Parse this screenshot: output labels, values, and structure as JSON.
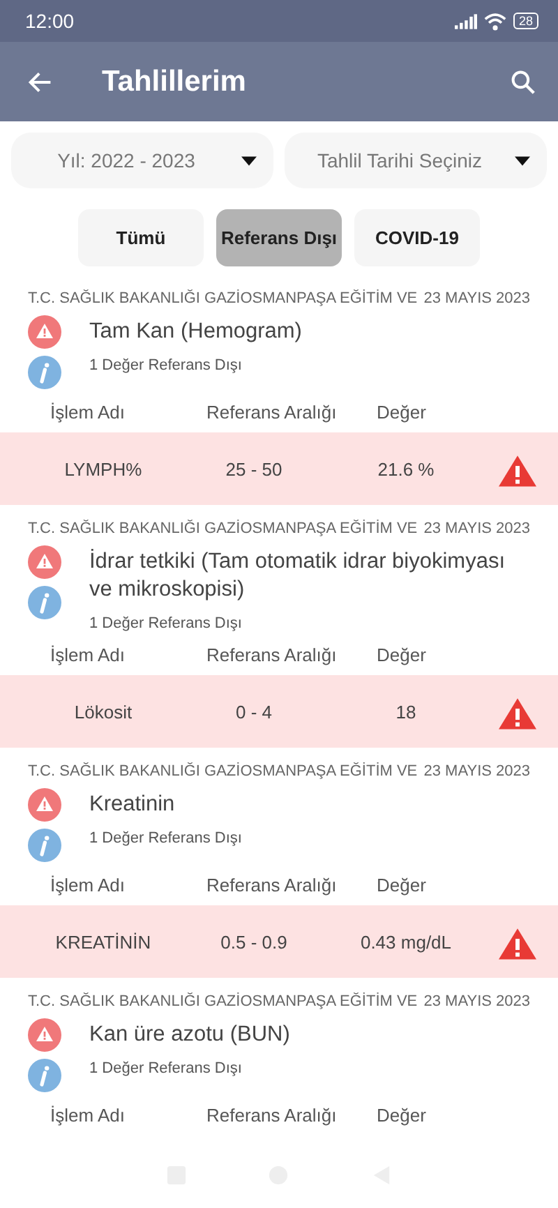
{
  "status_bar": {
    "time": "12:00",
    "battery": "28"
  },
  "app_bar": {
    "title": "Tahlillerim"
  },
  "filters": [
    {
      "label": "Yıl: 2022 - 2023"
    },
    {
      "label": "Tahlil Tarihi Seçiniz"
    }
  ],
  "chips": [
    {
      "label": "Tümü",
      "selected": false
    },
    {
      "label": "Referans Dışı",
      "selected": true
    },
    {
      "label": "COVID-19",
      "selected": false
    }
  ],
  "results": [
    {
      "institution": "T.C. SAĞLIK BAKANLIĞI GAZİOSMANPAŞA EĞİTİM VE",
      "date": "23 MAYIS 2023",
      "test": "Tam Kan (Hemogram)",
      "summary": "1 Değer Referans Dışı",
      "columns": [
        "İşlem Adı",
        "Referans Aralığı",
        "Değer"
      ],
      "rows": [
        {
          "name": "LYMPH%",
          "range": "25 - 50",
          "value": "21.6 %",
          "out_of_range": true
        }
      ]
    },
    {
      "institution": "T.C. SAĞLIK BAKANLIĞI GAZİOSMANPAŞA EĞİTİM VE",
      "date": "23 MAYIS 2023",
      "test": "İdrar tetkiki (Tam otomatik idrar biyokimyası ve mikroskopisi)",
      "summary": "1 Değer Referans Dışı",
      "columns": [
        "İşlem Adı",
        "Referans Aralığı",
        "Değer"
      ],
      "rows": [
        {
          "name": "Lökosit",
          "range": "0 - 4",
          "value": "18",
          "out_of_range": true
        }
      ]
    },
    {
      "institution": "T.C. SAĞLIK BAKANLIĞI GAZİOSMANPAŞA EĞİTİM VE",
      "date": "23 MAYIS 2023",
      "test": "Kreatinin",
      "summary": "1 Değer Referans Dışı",
      "columns": [
        "İşlem Adı",
        "Referans Aralığı",
        "Değer"
      ],
      "rows": [
        {
          "name": "KREATİNİN",
          "range": "0.5 - 0.9",
          "value": "0.43 mg/dL",
          "out_of_range": true
        }
      ]
    },
    {
      "institution": "T.C. SAĞLIK BAKANLIĞI GAZİOSMANPAŞA EĞİTİM VE",
      "date": "23 MAYIS 2023",
      "test": "Kan üre azotu (BUN)",
      "summary": "1 Değer Referans Dışı",
      "columns": [
        "İşlem Adı",
        "Referans Aralığı",
        "Değer"
      ]
    }
  ]
}
